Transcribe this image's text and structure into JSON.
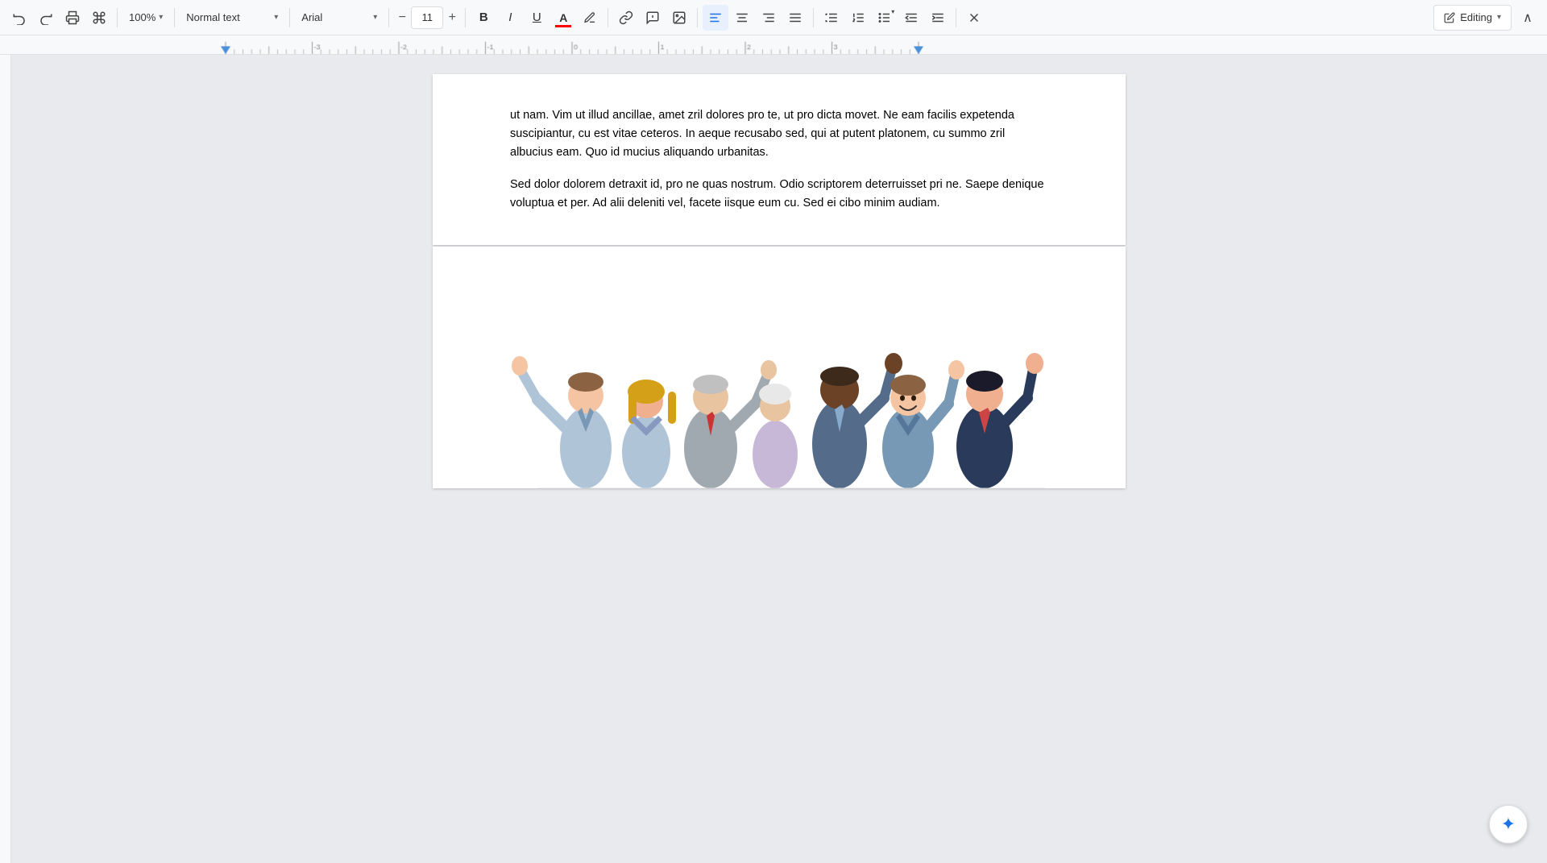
{
  "toolbar": {
    "undo_label": "↩",
    "redo_label": "↪",
    "print_label": "🖨",
    "paint_label": "🎨",
    "zoom": "100%",
    "zoom_chevron": "▾",
    "style_label": "Normal text",
    "style_chevron": "▾",
    "font_label": "Arial",
    "font_chevron": "▾",
    "font_size": "11",
    "font_size_chevron": "▾",
    "bold": "B",
    "italic": "I",
    "underline": "U",
    "text_color": "A",
    "highlight": "🖊",
    "link": "🔗",
    "image_insert": "+🖼",
    "image": "🖼",
    "align_left": "≡",
    "align_center": "≡",
    "align_right": "≡",
    "align_justify": "≡",
    "line_spacing": "↕",
    "numbered_list": "1≡",
    "bulleted_list": "•≡",
    "decrease_indent": "⇤",
    "increase_indent": "⇥",
    "clear_formatting": "✕",
    "editing_label": "Editing",
    "editing_chevron": "▾",
    "collapse": "∧"
  },
  "document": {
    "page1": {
      "paragraph1": "ut nam. Vim ut illud ancillae, amet zril dolores pro te, ut pro dicta movet. Ne eam facilis expetenda suscipiantur, cu est vitae ceteros. In aeque recusabo sed, qui at putent platonem, cu summo zril albucius eam. Quo id mucius aliquando urbanitas.",
      "paragraph2": "Sed dolor dolorem detraxit id, pro ne quas nostrum. Odio scriptorem deterruisset pri ne. Saepe denique voluptua et per. Ad alii deleniti vel, facete iisque eum cu. Sed ei cibo minim audiam."
    }
  },
  "ai_button": {
    "label": "✦"
  }
}
